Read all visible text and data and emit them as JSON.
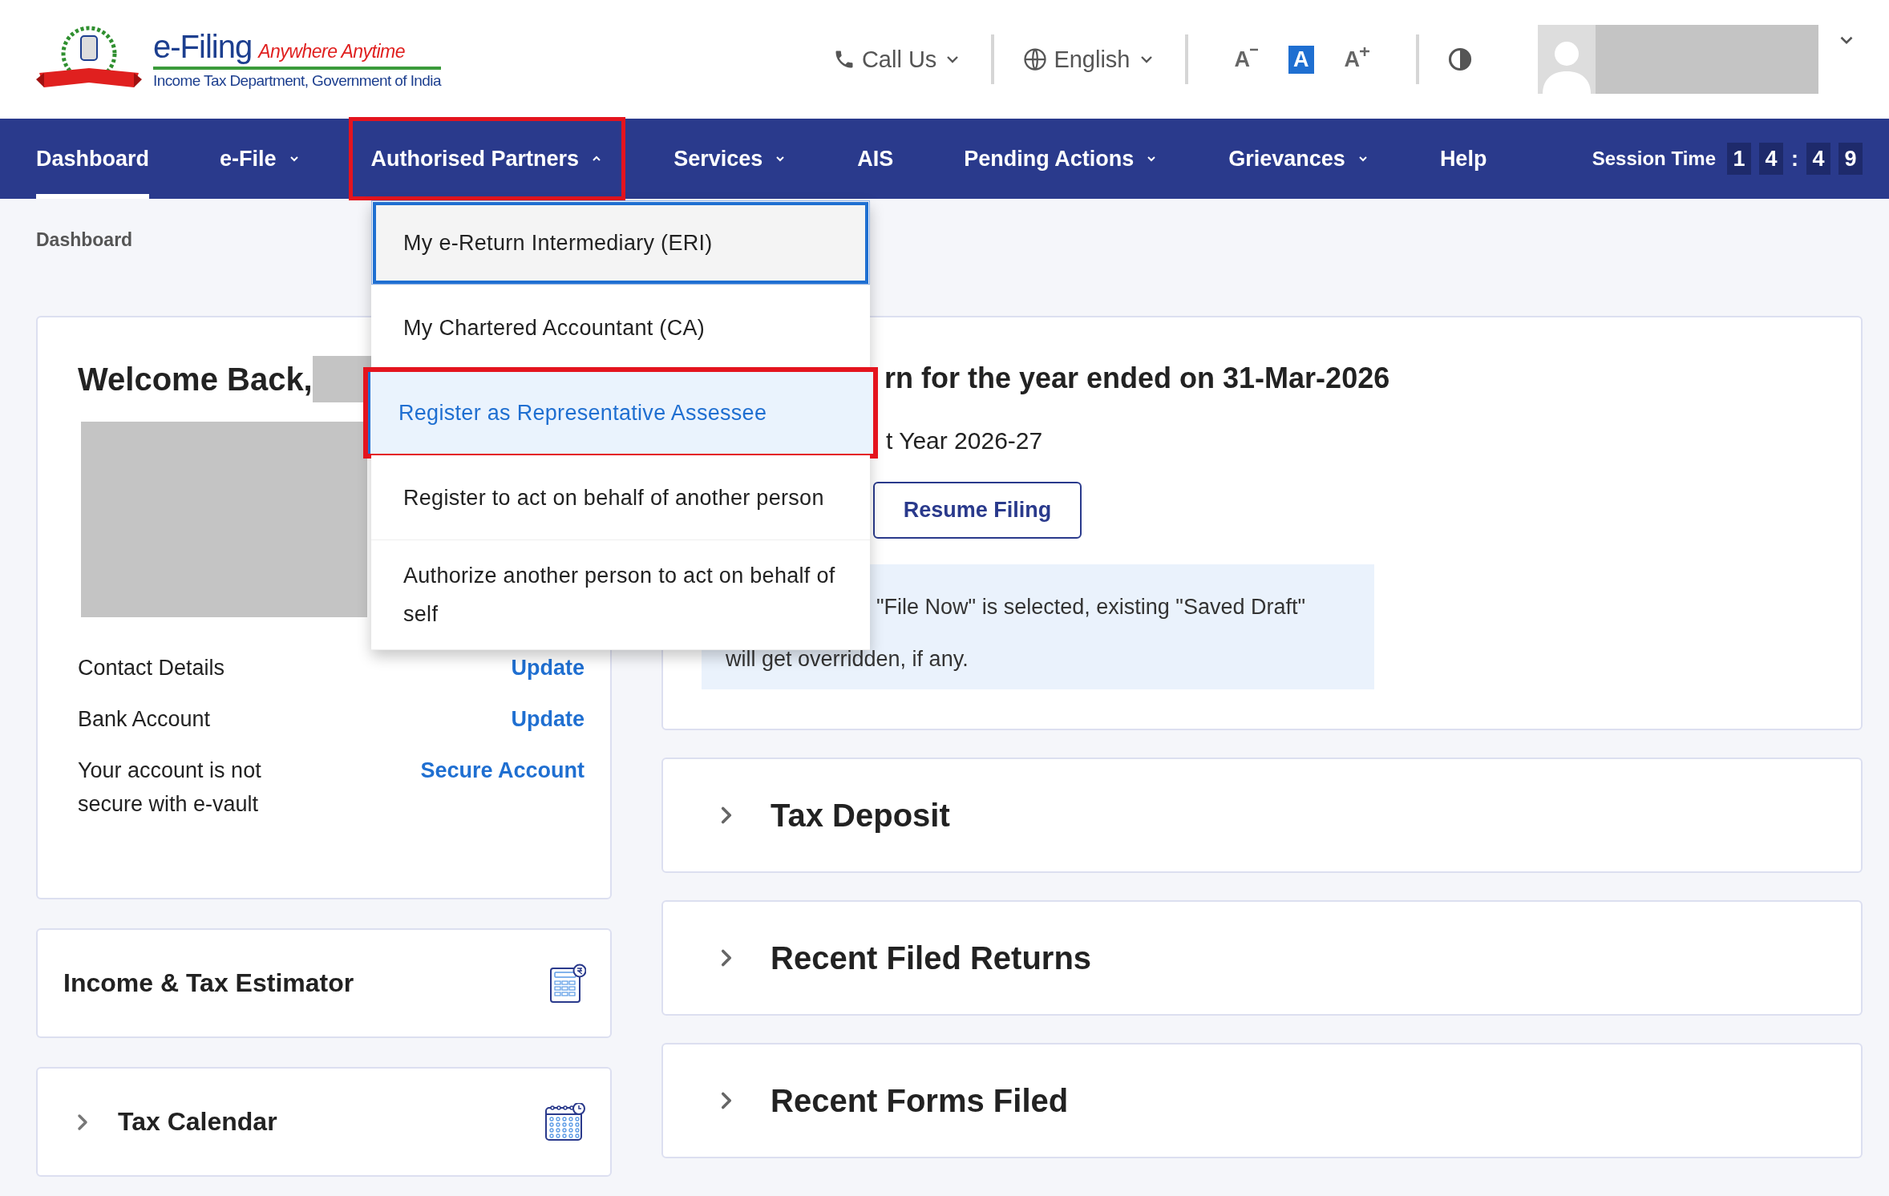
{
  "header": {
    "brand": {
      "title": "e-Filing",
      "tagline": "Anywhere Anytime",
      "subtitle": "Income Tax Department, Government of India"
    },
    "call_us": {
      "label": "Call Us"
    },
    "language": {
      "label": "English"
    },
    "font_size_controls": [
      {
        "label": "A",
        "kind": "decrease",
        "selected": false
      },
      {
        "label": "A",
        "kind": "default",
        "selected": true
      },
      {
        "label": "A",
        "kind": "increase",
        "selected": false
      }
    ]
  },
  "nav": {
    "items": [
      {
        "label": "Dashboard",
        "selected": true,
        "highlighted": false
      },
      {
        "label": "e-File",
        "selected": false,
        "expanded": false,
        "highlighted": false
      },
      {
        "label": "Authorised Partners",
        "selected": false,
        "expanded": true,
        "highlighted": true
      },
      {
        "label": "Services",
        "selected": false,
        "expanded": false,
        "highlighted": false
      },
      {
        "label": "AIS",
        "selected": false,
        "highlighted": false
      },
      {
        "label": "Pending Actions",
        "selected": false,
        "expanded": false,
        "highlighted": false
      },
      {
        "label": "Grievances",
        "selected": false,
        "expanded": false,
        "highlighted": false
      },
      {
        "label": "Help",
        "selected": false,
        "highlighted": false
      }
    ],
    "session": {
      "label": "Session Time",
      "time": [
        {
          "text": "1",
          "kind": "digit"
        },
        {
          "text": "4",
          "kind": "digit"
        },
        {
          "text": ":",
          "kind": "separator"
        },
        {
          "text": "4",
          "kind": "digit"
        },
        {
          "text": "9",
          "kind": "digit"
        }
      ]
    }
  },
  "dropdown": {
    "items": [
      {
        "label": "My e-Return Intermediary (ERI)",
        "focused": true,
        "selected": false,
        "highlighted": false
      },
      {
        "label": "My Chartered Accountant (CA)",
        "focused": false,
        "selected": false,
        "highlighted": false
      },
      {
        "label": "Register as Representative Assessee",
        "focused": false,
        "selected": true,
        "highlighted": true
      },
      {
        "label": "Register to act on behalf of another person",
        "focused": false,
        "selected": false,
        "highlighted": false
      },
      {
        "label": "Authorize another person to act on behalf of self",
        "focused": false,
        "selected": false,
        "highlighted": false
      }
    ]
  },
  "breadcrumb": "Dashboard",
  "welcome": {
    "greeting": "Welcome Back,",
    "rows": [
      {
        "label": "Contact Details",
        "link": "Update"
      },
      {
        "label": "Bank Account",
        "link": "Update"
      },
      {
        "label": "Your account is not secure with e-vault",
        "link": "Secure Account"
      }
    ]
  },
  "tools": [
    {
      "title": "Income & Tax Estimator",
      "kind": "calculator",
      "expandable": false
    },
    {
      "title": "Tax Calendar",
      "kind": "calendar",
      "expandable": true
    }
  ],
  "filing": {
    "title": "rn for the year ended on 31-Mar-2026",
    "subtitle": "t Year 2026-27",
    "button": "Resume Filing",
    "note_line_1": "\"File Now\" is selected, existing \"Saved Draft\"",
    "note_line_2": "will get overridden, if any."
  },
  "sections": [
    {
      "title": "Tax Deposit",
      "expanded": false
    },
    {
      "title": "Recent Filed Returns",
      "expanded": false
    },
    {
      "title": "Recent Forms Filed",
      "expanded": false
    }
  ]
}
